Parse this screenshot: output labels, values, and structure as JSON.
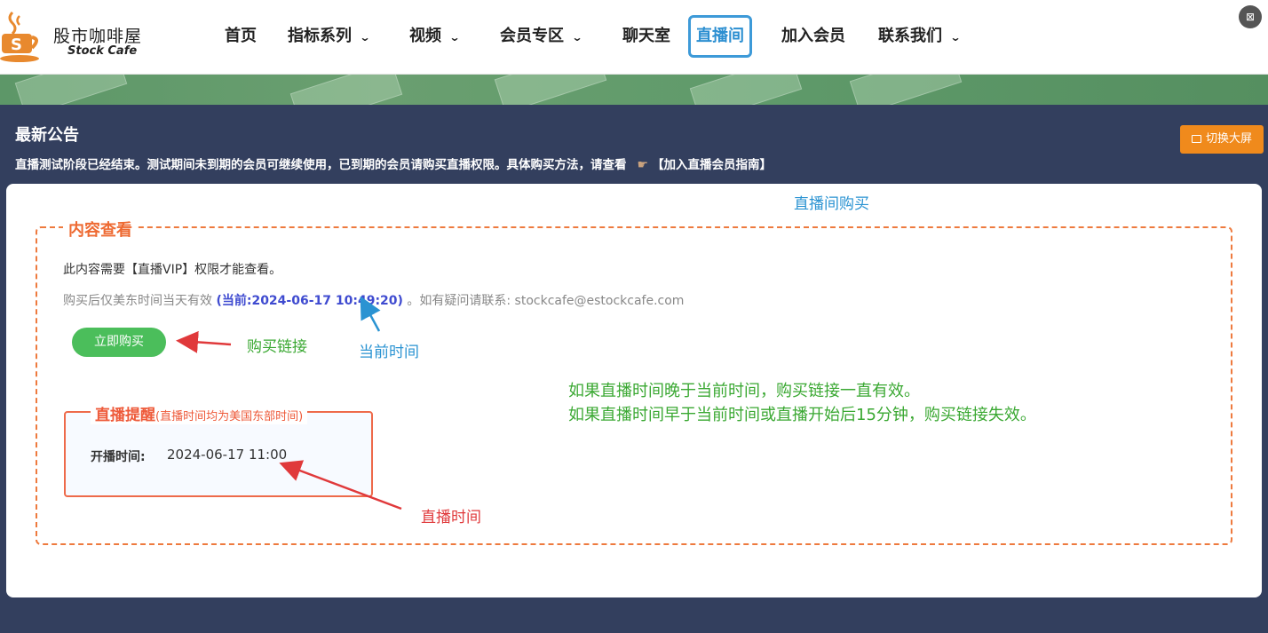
{
  "header": {
    "logo_cn": "股市咖啡屋",
    "logo_en": "Stock Cafe",
    "nav": [
      {
        "label": "首页",
        "dropdown": false,
        "active": false
      },
      {
        "label": "指标系列",
        "dropdown": true,
        "active": false
      },
      {
        "label": "视频",
        "dropdown": true,
        "active": false
      },
      {
        "label": "会员专区",
        "dropdown": true,
        "active": false
      },
      {
        "label": "聊天室",
        "dropdown": false,
        "active": false
      },
      {
        "label": "直播间",
        "dropdown": false,
        "active": true
      },
      {
        "label": "加入会员",
        "dropdown": false,
        "active": false
      },
      {
        "label": "联系我们",
        "dropdown": true,
        "active": false
      }
    ],
    "chevron": "⌄",
    "help_icon": "⊠"
  },
  "notice": {
    "title": "最新公告",
    "text": "直播测试阶段已经结束。测试期间未到期的会员可继续使用，已到期的会员请购买直播权限。具体购买方法，请查看",
    "link": "【加入直播会员指南】",
    "hand_icon": "pointing-hand-icon"
  },
  "fullscreen_button": "切换大屏",
  "card": {
    "annotation_title": "直播间购买",
    "legend": "内容查看",
    "need_vip": "此内容需要【直播VIP】权限才能查看。",
    "buy_info_prefix": "购买后仅美东时间当天有效",
    "buy_info_now": "(当前:2024-06-17 10:49:20)",
    "buy_info_suffix": "。如有疑问请联系: stockcafe@estockcafe.com",
    "buy_button": "立即购买",
    "annotation_buy_link": "购买链接",
    "annotation_current_time": "当前时间",
    "live_legend": "直播提醒",
    "live_legend_note": "(直播时间均为美国东部时间)",
    "start_label": "开播时间:",
    "start_value": "2024-06-17 11:00",
    "annotation_live_time": "直播时间",
    "note_line1": "如果直播时间晚于当前时间，购买链接一直有效。",
    "note_line2": "如果直播时间早于当前时间或直播开始后15分钟，购买链接失效。"
  },
  "colors": {
    "page_bg": "#333f5e",
    "active_nav": "#3d9ad8",
    "orange": "#f08a1c",
    "dashed_border": "#ee7a3e",
    "buy_green": "#4bbe5b",
    "note_green": "#3aa832",
    "annotation_red": "#e0393b",
    "annotation_blue": "#2a93d2"
  }
}
